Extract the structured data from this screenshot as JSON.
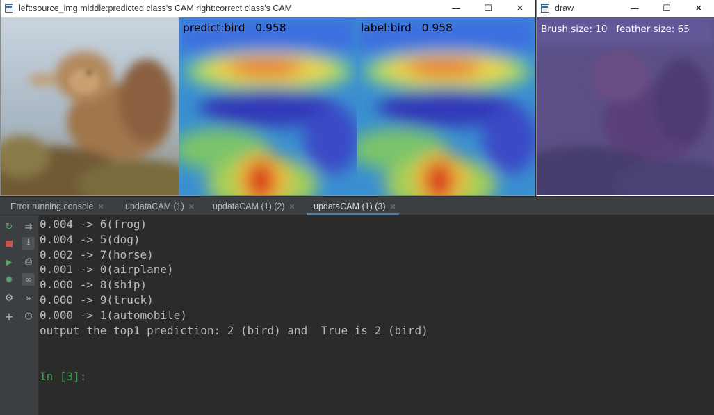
{
  "windows": {
    "main": {
      "title": "left:source_img    middle:predicted class's CAM    right:correct class's CAM",
      "controls": {
        "minimize": "—",
        "maximize": "☐",
        "close": "✕"
      }
    },
    "draw": {
      "title": "draw",
      "controls": {
        "minimize": "—",
        "maximize": "☐",
        "close": "✕"
      }
    }
  },
  "panels": {
    "predicted_cam_label": "predict:bird   0.958",
    "correct_cam_label": "label:bird   0.958",
    "draw_label": "Brush size: 10   feather size: 65"
  },
  "tabs": [
    {
      "label": "Error running console",
      "active": false
    },
    {
      "label": "updataCAM (1)",
      "active": false
    },
    {
      "label": "updataCAM (1) (2)",
      "active": false
    },
    {
      "label": "updataCAM (1) (3)",
      "active": true
    }
  ],
  "toolbar": {
    "rerun_icon": "rerun-icon",
    "stop_icon": "stop-icon",
    "run_icon": "run-icon",
    "debug_icon": "debug-icon",
    "settings_icon": "settings-icon",
    "add_icon": "add-icon",
    "softwrap_icon": "soft-wrap-icon",
    "scroll_end_icon": "scroll-to-end-icon",
    "print_icon": "print-icon",
    "view_icon": "view-variables-icon",
    "step_icon": "step-icon",
    "history_icon": "history-icon"
  },
  "console": {
    "lines": [
      "0.004 -> 6(frog)",
      "0.004 -> 5(dog)",
      "0.002 -> 7(horse)",
      "0.001 -> 0(airplane)",
      "0.000 -> 8(ship)",
      "0.000 -> 9(truck)",
      "0.000 -> 1(automobile)",
      "output the top1 prediction: 2 (bird) and  True is 2 (bird)"
    ],
    "prompt": "In [3]:"
  },
  "colors": {
    "console_bg": "#2b2b2b",
    "console_text": "#bababa",
    "prompt": "#499c54",
    "tab_bar": "#3c3f41"
  }
}
